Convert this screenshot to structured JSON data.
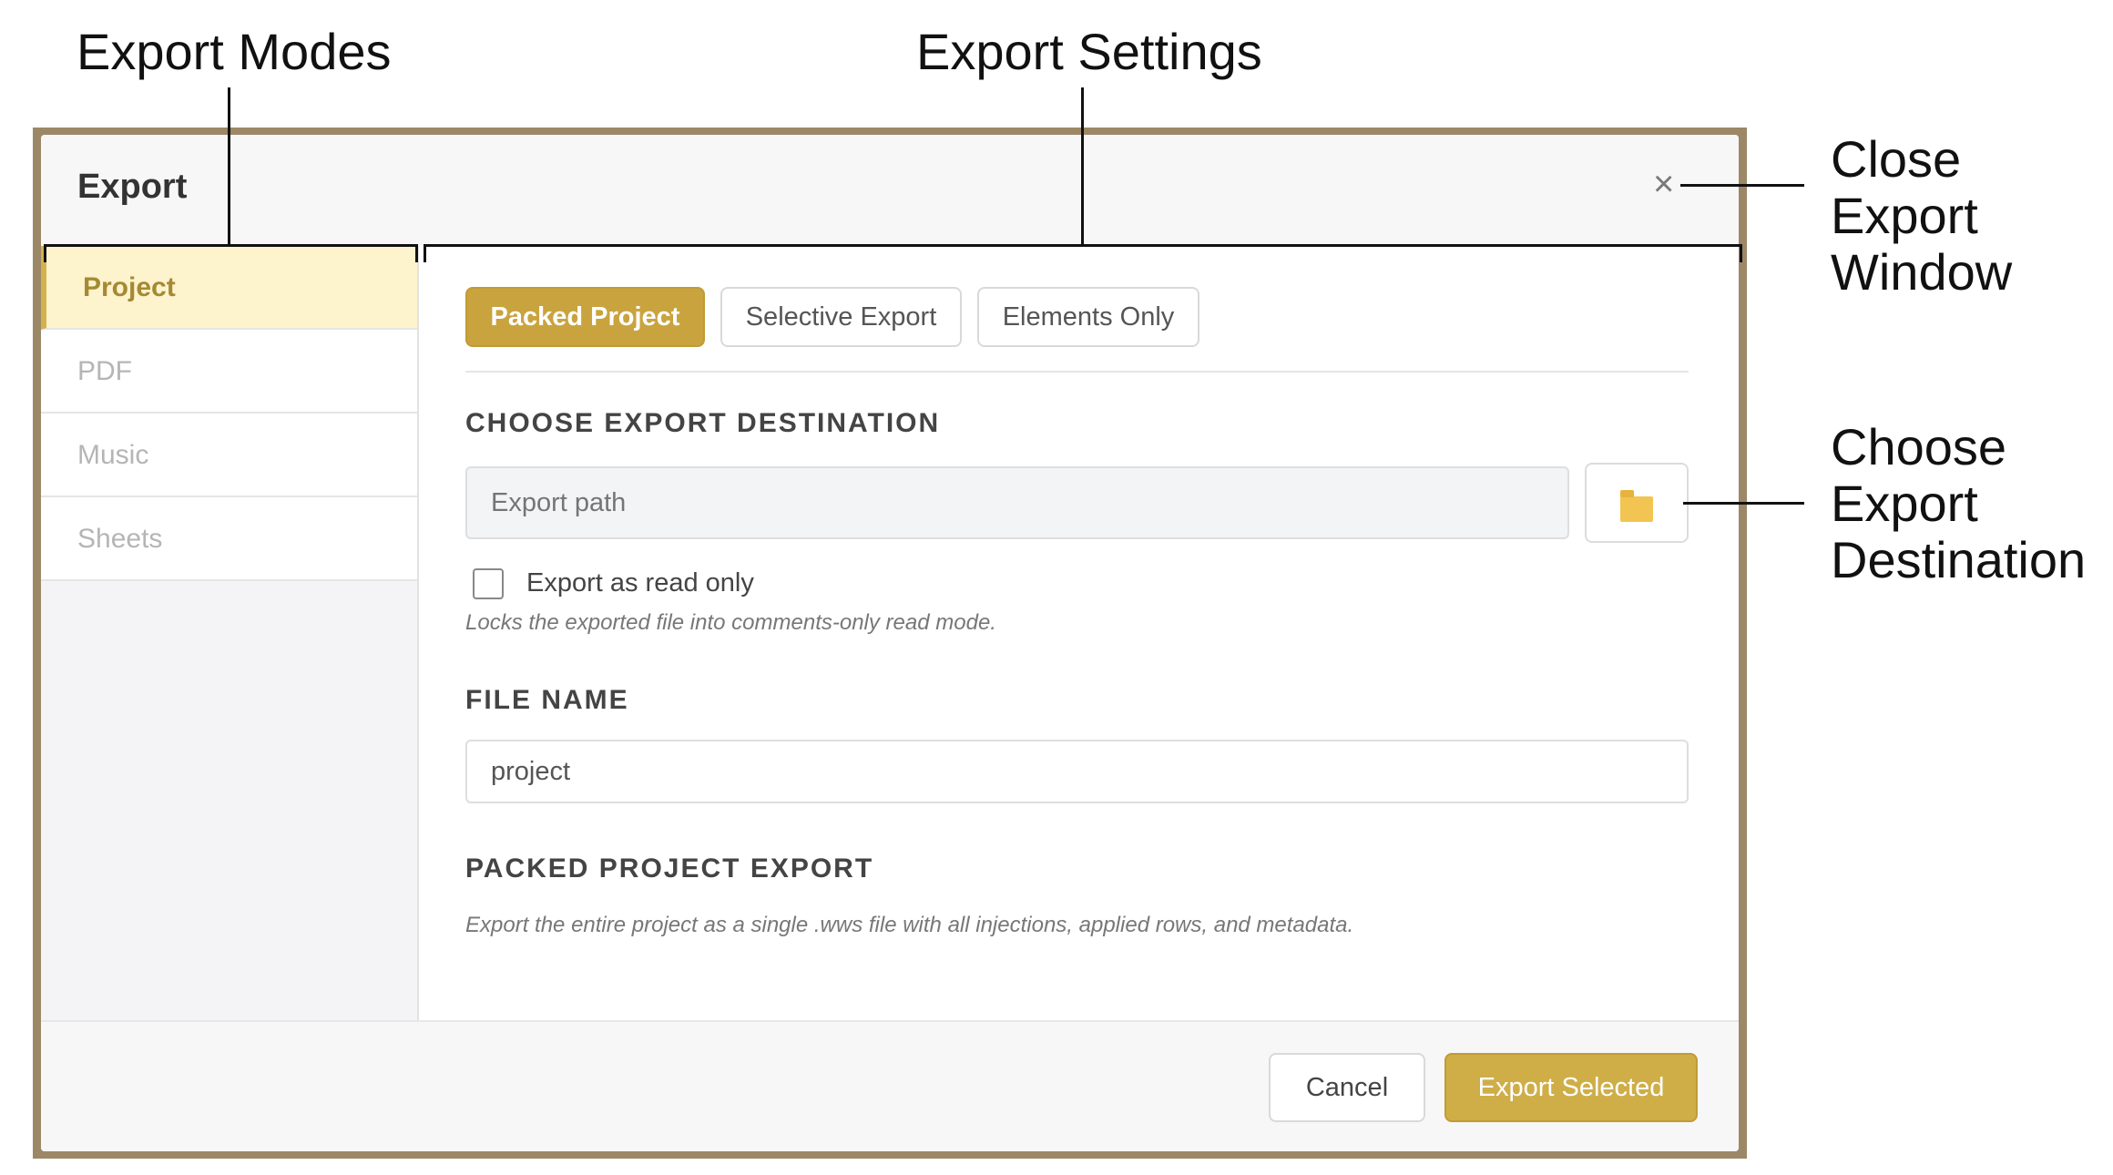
{
  "annotations": {
    "export_modes": "Export Modes",
    "export_settings": "Export Settings",
    "close_export_window": "Close Export\nWindow",
    "choose_export_destination": "Choose\nExport\nDestination"
  },
  "dialog": {
    "title": "Export",
    "close_icon": "×"
  },
  "sidebar": {
    "items": [
      {
        "label": "Project",
        "active": true
      },
      {
        "label": "PDF",
        "active": false
      },
      {
        "label": "Music",
        "active": false
      },
      {
        "label": "Sheets",
        "active": false
      }
    ]
  },
  "tabs": [
    {
      "label": "Packed Project",
      "active": true
    },
    {
      "label": "Selective Export",
      "active": false
    },
    {
      "label": "Elements Only",
      "active": false
    }
  ],
  "destination": {
    "heading": "CHOOSE EXPORT DESTINATION",
    "placeholder": "Export path",
    "value": "",
    "browse_icon": "folder-icon",
    "read_only_label": "Export as read only",
    "read_only_checked": false,
    "read_only_hint": "Locks the exported file into comments-only read mode."
  },
  "file_name": {
    "heading": "FILE NAME",
    "value": "project"
  },
  "packed": {
    "heading": "PACKED PROJECT EXPORT",
    "description": "Export the entire project as a single .wws file with all injections, applied rows, and metadata."
  },
  "footer": {
    "cancel_label": "Cancel",
    "export_label": "Export Selected"
  },
  "colors": {
    "accent": "#cfae48",
    "frame": "#9c8866",
    "active_sidebar_bg": "#fdf3cd"
  }
}
